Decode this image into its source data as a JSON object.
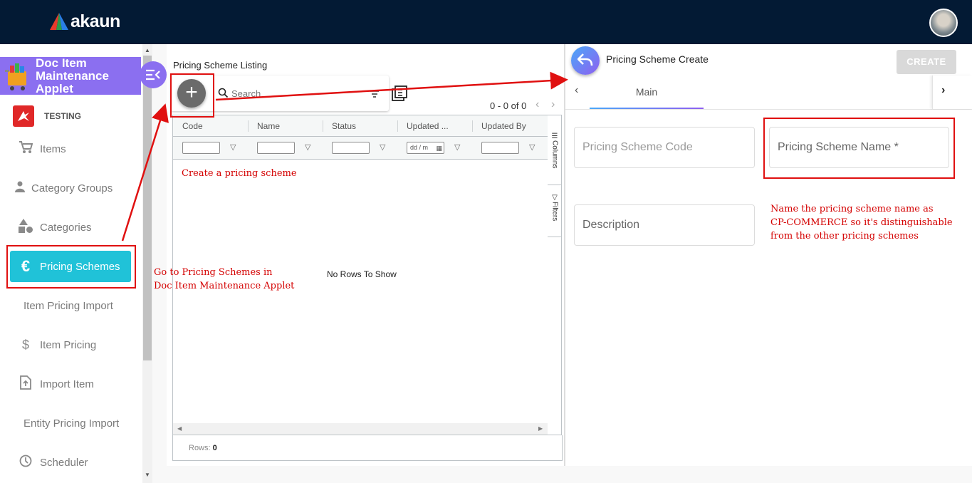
{
  "topbar": {
    "brand": "akaun",
    "avatar_icon": "user-avatar"
  },
  "sidebar": {
    "applet_title": "Doc Item Maintenance Applet",
    "collapse_icon": "collapse-menu-icon",
    "tenant_label": "TESTING",
    "items": [
      {
        "label": "Items",
        "icon": "cart-icon"
      },
      {
        "label": "Category Groups",
        "icon": "person-icon"
      },
      {
        "label": "Categories",
        "icon": "shapes-icon"
      },
      {
        "label": "Pricing Schemes",
        "icon": "euro-icon",
        "active": true
      },
      {
        "label": "Item Pricing Import",
        "icon": ""
      },
      {
        "label": "Item Pricing",
        "icon": "dollar-icon"
      },
      {
        "label": "Import Item",
        "icon": "file-upload-icon"
      },
      {
        "label": "Entity Pricing Import",
        "icon": ""
      },
      {
        "label": "Scheduler",
        "icon": "clock-icon"
      }
    ]
  },
  "listing": {
    "title": "Pricing Scheme Listing",
    "search_placeholder": "Search",
    "pager_text": "0 - 0 of 0",
    "columns": [
      "Code",
      "Name",
      "Status",
      "Updated ...",
      "Updated By"
    ],
    "date_filter_placeholder": "dd / m",
    "no_rows": "No Rows To Show",
    "tool_columns": "Columns",
    "tool_filters": "Filters",
    "rows_label": "Rows:",
    "rows_count": "0"
  },
  "create_panel": {
    "title": "Pricing Scheme Create",
    "create_button": "CREATE",
    "tab_main": "Main",
    "fields": {
      "code": "Pricing Scheme Code",
      "name": "Pricing Scheme Name *",
      "description": "Description"
    }
  },
  "annotations": {
    "create_note": "Create a pricing scheme",
    "goto_line1": "Go to Pricing Schemes in",
    "goto_line2": "Doc Item Maintenance Applet",
    "name_line1": "Name the pricing scheme name as",
    "name_line2": "CP-COMMERCE so it's distinguishable",
    "name_line3": "from the other pricing schemes",
    "color": "#e01010"
  },
  "colors": {
    "topbar": "#031a34",
    "applet_accent": "#8b6ff0",
    "active_nav": "#20c2d8"
  }
}
